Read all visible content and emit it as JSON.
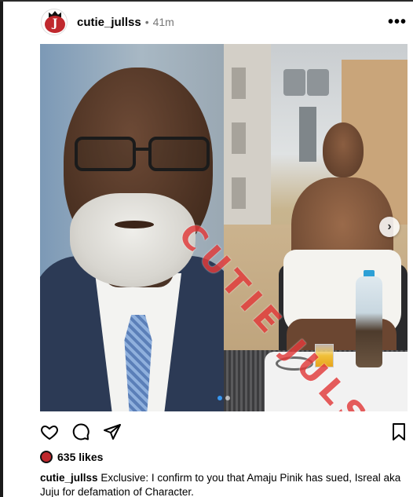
{
  "post": {
    "username": "cutie_jullss",
    "separator": "•",
    "time": "41m",
    "more_label": "•••",
    "watermark": "CUTIE JULS",
    "avatar_letter": "J",
    "next_label": "›",
    "likes": "635 likes",
    "caption_user": "cutie_jullss",
    "caption_text": "Exclusive: I confirm to you that Amaju Pinik has sued, Isreal aka Juju for defamation of Character.",
    "carousel": {
      "count": 2,
      "active": 1
    }
  },
  "icons": {
    "like": "heart-icon",
    "comment": "comment-icon",
    "share": "send-icon",
    "save": "bookmark-icon"
  },
  "colors": {
    "watermark": "#e23a3a",
    "carousel_active": "#3897f0",
    "brand": "#c0282d"
  }
}
